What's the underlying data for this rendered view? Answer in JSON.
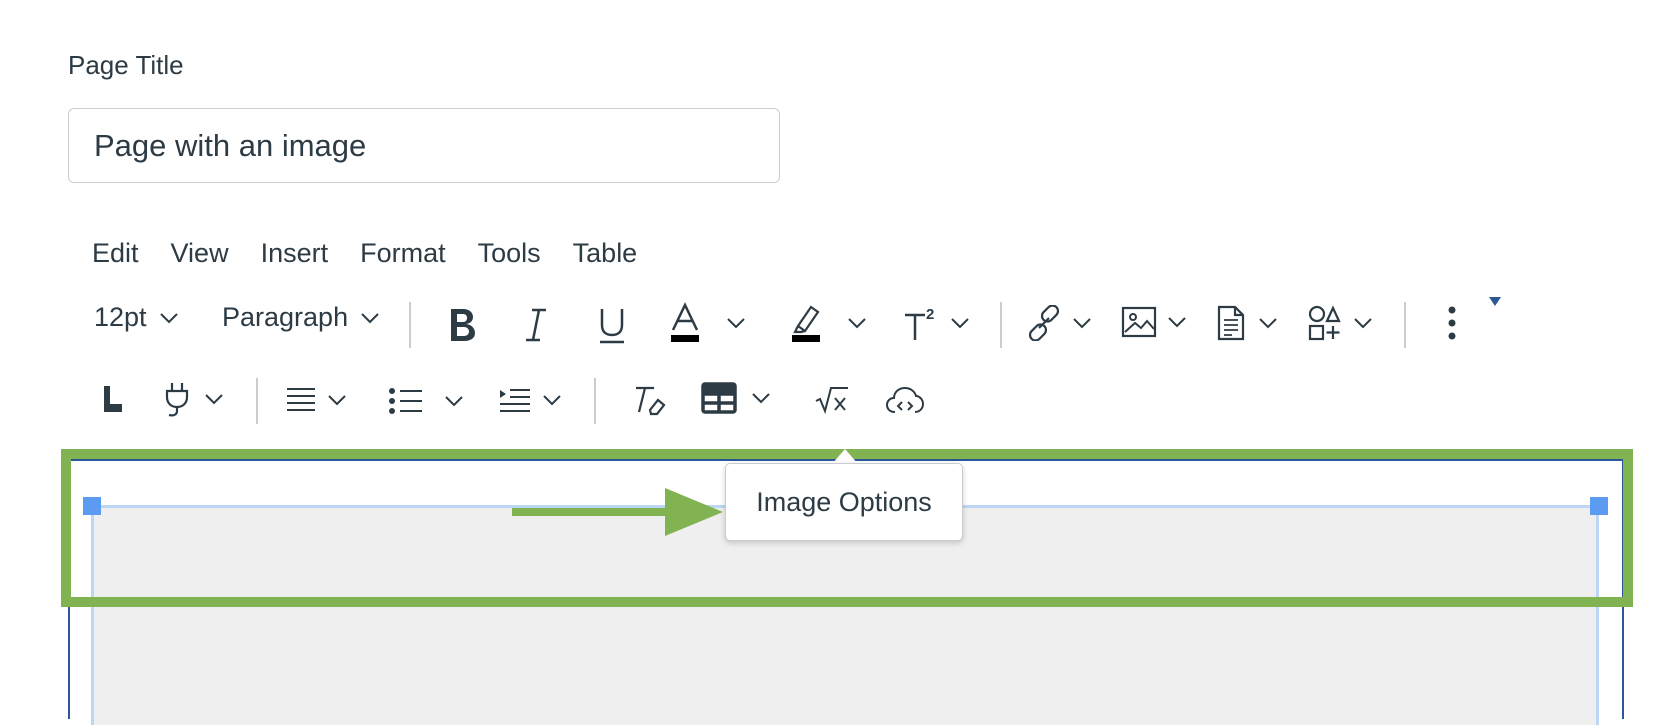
{
  "page_title": {
    "label": "Page Title",
    "value": "Page with an image"
  },
  "menubar": {
    "items": [
      "Edit",
      "View",
      "Insert",
      "Format",
      "Tools",
      "Table"
    ]
  },
  "toolbar": {
    "font_size": "12pt",
    "block_format": "Paragraph"
  },
  "tooltip": {
    "text": "Image Options"
  },
  "colors": {
    "highlight": "#82b352",
    "editor_border": "#2b5797",
    "selection": "#5b9cf2",
    "text": "#2d3b45"
  }
}
